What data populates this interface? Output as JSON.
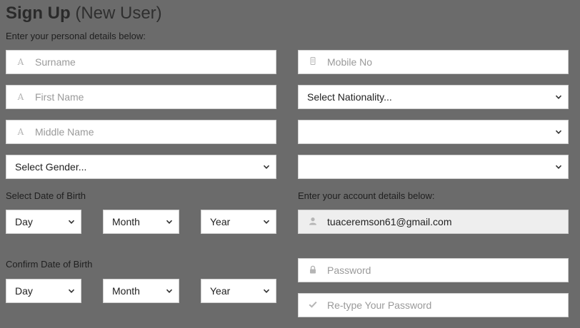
{
  "header": {
    "title": "Sign Up",
    "subtitle": "(New User)"
  },
  "personal": {
    "instruction": "Enter your personal details below:",
    "surname": {
      "placeholder": "Surname",
      "icon": "font-letter-icon"
    },
    "first_name": {
      "placeholder": "First Name",
      "icon": "font-letter-icon"
    },
    "middle_name": {
      "placeholder": "Middle Name",
      "icon": "font-letter-icon"
    },
    "gender": {
      "selected": "Select Gender..."
    },
    "mobile": {
      "placeholder": "Mobile No",
      "icon": "mobile-phone-icon"
    },
    "nationality": {
      "selected": "Select Nationality..."
    },
    "extra_select_1": {
      "selected": ""
    },
    "extra_select_2": {
      "selected": ""
    }
  },
  "dob": {
    "label": "Select Date of Birth",
    "day": "Day",
    "month": "Month",
    "year": "Year"
  },
  "confirm_dob": {
    "label": "Confirm Date of Birth",
    "day": "Day",
    "month": "Month",
    "year": "Year"
  },
  "account": {
    "instruction": "Enter your account details below:",
    "email": {
      "value": "tuaceremson61@gmail.com",
      "icon": "user-icon"
    },
    "password": {
      "placeholder": "Password",
      "icon": "lock-icon"
    },
    "retype_password": {
      "placeholder": "Re-type Your Password",
      "icon": "check-icon"
    }
  },
  "colors": {
    "background": "#6b6b6b",
    "field": "#ffffff",
    "field_disabled": "#eeeeee",
    "placeholder": "#9a9a9a"
  }
}
